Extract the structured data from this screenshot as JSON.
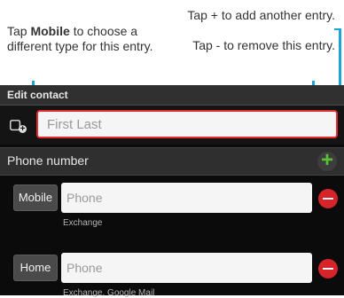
{
  "callouts": {
    "left": {
      "pre": "Tap ",
      "bold": "Mobile",
      "post": " to choose a different type for this entry."
    },
    "right_add": "Tap + to add another entry.",
    "right_remove": "Tap - to remove this entry."
  },
  "screen": {
    "title": "Edit contact",
    "name_field": {
      "placeholder": "First Last"
    },
    "phone_section": {
      "label": "Phone number",
      "add_symbol": "+"
    },
    "entries": [
      {
        "type_label": "Mobile",
        "placeholder": "Phone",
        "account": "Exchange"
      },
      {
        "type_label": "Home",
        "placeholder": "Phone",
        "account": "Exchange, Google Mail"
      }
    ]
  },
  "colors": {
    "callout_line": "#1ba5d6",
    "add_green": "#58c234",
    "remove_red": "#d7242b",
    "focus_border": "#e52c2c"
  }
}
